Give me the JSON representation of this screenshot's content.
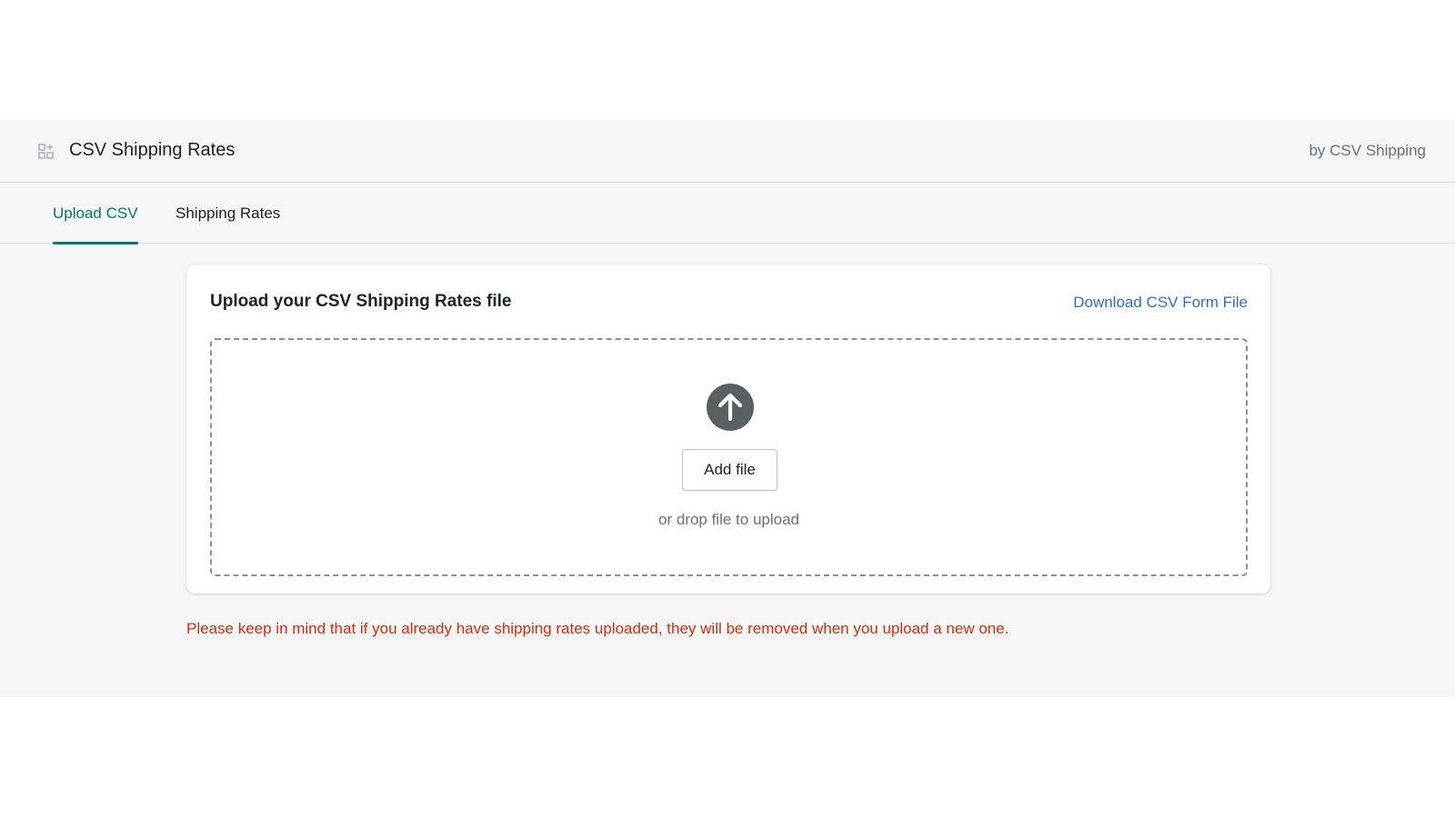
{
  "header": {
    "app_icon": "apps-grid-icon",
    "title": "CSV Shipping Rates",
    "vendor": "by CSV Shipping"
  },
  "tabs": [
    {
      "label": "Upload CSV",
      "active": true
    },
    {
      "label": "Shipping Rates",
      "active": false
    }
  ],
  "upload_card": {
    "title": "Upload your CSV Shipping Rates file",
    "download_link": "Download CSV Form File",
    "dropzone": {
      "icon": "arrow-up-circle-icon",
      "add_button": "Add file",
      "hint": "or drop file to upload"
    }
  },
  "warning": "Please keep in mind that if you already have shipping rates uploaded, they will be removed when you upload a new one.",
  "colors": {
    "accent": "#008060",
    "link": "#2c6ecb",
    "critical": "#d72c0d",
    "icon_dark": "#5c5f62"
  }
}
